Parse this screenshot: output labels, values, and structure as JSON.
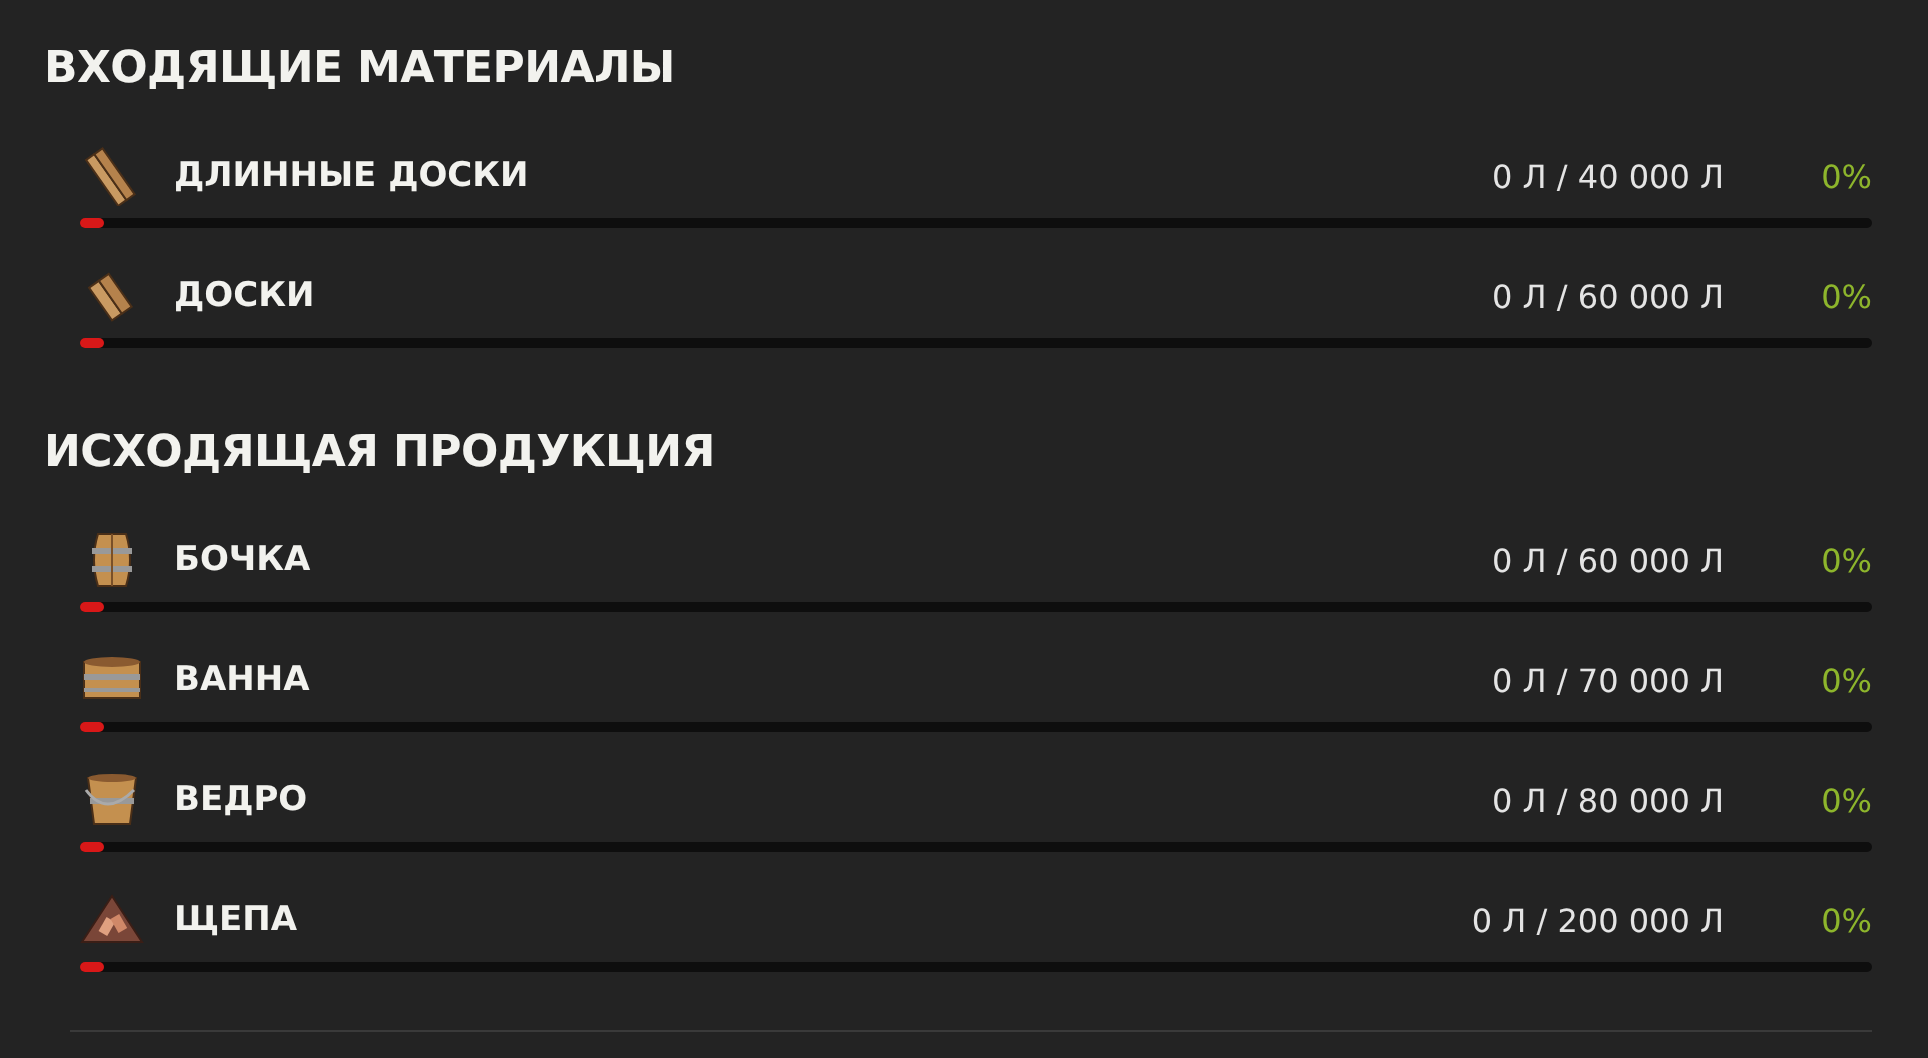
{
  "sections": [
    {
      "title": "ВХОДЯЩИЕ МАТЕРИАЛЫ",
      "items": [
        {
          "name": "ДЛИННЫЕ ДОСКИ",
          "amount": "0 Л / 40 000 Л",
          "percent": "0%",
          "level": 0
        },
        {
          "name": "ДОСКИ",
          "amount": "0 Л / 60 000 Л",
          "percent": "0%",
          "level": 0
        }
      ]
    },
    {
      "title": "ИСХОДЯЩАЯ ПРОДУКЦИЯ",
      "items": [
        {
          "name": "БОЧКА",
          "amount": "0 Л / 60 000 Л",
          "percent": "0%",
          "level": 0
        },
        {
          "name": "ВАННА",
          "amount": "0 Л / 70 000 Л",
          "percent": "0%",
          "level": 0
        },
        {
          "name": "ВЕДРО",
          "amount": "0 Л / 80 000 Л",
          "percent": "0%",
          "level": 0
        },
        {
          "name": "ЩЕПА",
          "amount": "0 Л / 200 000 Л",
          "percent": "0%",
          "level": 0
        }
      ]
    }
  ]
}
